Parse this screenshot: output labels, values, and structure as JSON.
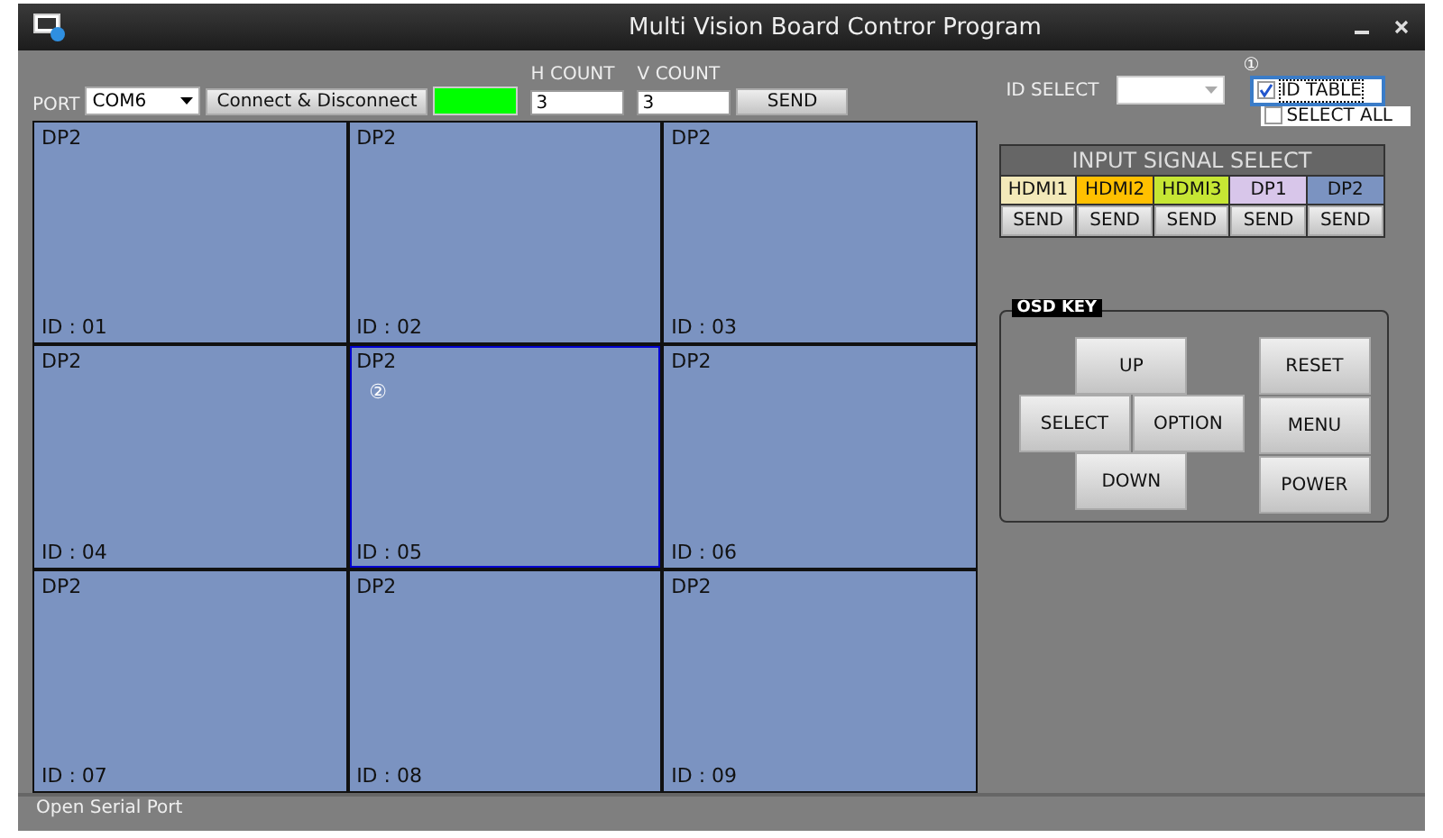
{
  "window": {
    "title": "Multi Vision Board Contror Program"
  },
  "port": {
    "label": "PORT",
    "value": "COM6",
    "connect_button": "Connect & Disconnect",
    "connected": true
  },
  "count": {
    "h_label": "H COUNT",
    "h_value": "3",
    "v_label": "V COUNT",
    "v_value": "3",
    "send": "SEND"
  },
  "cells": [
    {
      "source": "DP2",
      "id": "ID : 01",
      "selected": false,
      "color": "#7b93c1"
    },
    {
      "source": "DP2",
      "id": "ID : 02",
      "selected": false,
      "color": "#7b93c1"
    },
    {
      "source": "DP2",
      "id": "ID : 03",
      "selected": false,
      "color": "#7b93c1"
    },
    {
      "source": "DP2",
      "id": "ID : 04",
      "selected": false,
      "color": "#7b93c1"
    },
    {
      "source": "DP2",
      "id": "ID : 05",
      "selected": true,
      "color": "#7b93c1",
      "marker": "②"
    },
    {
      "source": "DP2",
      "id": "ID : 06",
      "selected": false,
      "color": "#7b93c1"
    },
    {
      "source": "DP2",
      "id": "ID : 07",
      "selected": false,
      "color": "#7b93c1"
    },
    {
      "source": "DP2",
      "id": "ID : 08",
      "selected": false,
      "color": "#7b93c1"
    },
    {
      "source": "DP2",
      "id": "ID : 09",
      "selected": false,
      "color": "#7b93c1"
    }
  ],
  "id_select": {
    "label": "ID SELECT",
    "marker": "①",
    "id_table": {
      "label": "ID TABLE",
      "checked": true
    },
    "select_all": {
      "label": "SELECT ALL",
      "checked": false
    }
  },
  "input_signal": {
    "title": "INPUT SIGNAL SELECT",
    "sources": [
      {
        "label": "HDMI1",
        "color": "#f3e9b9",
        "send": "SEND"
      },
      {
        "label": "HDMI2",
        "color": "#ffc000",
        "send": "SEND"
      },
      {
        "label": "HDMI3",
        "color": "#c6e634",
        "send": "SEND"
      },
      {
        "label": "DP1",
        "color": "#d8c6ea",
        "send": "SEND"
      },
      {
        "label": "DP2",
        "color": "#7b93c1",
        "send": "SEND"
      }
    ]
  },
  "osd": {
    "title": "OSD KEY",
    "up": "UP",
    "select": "SELECT",
    "option": "OPTION",
    "down": "DOWN",
    "reset": "RESET",
    "menu": "MENU",
    "power": "POWER"
  },
  "status_bar": "Open Serial Port"
}
